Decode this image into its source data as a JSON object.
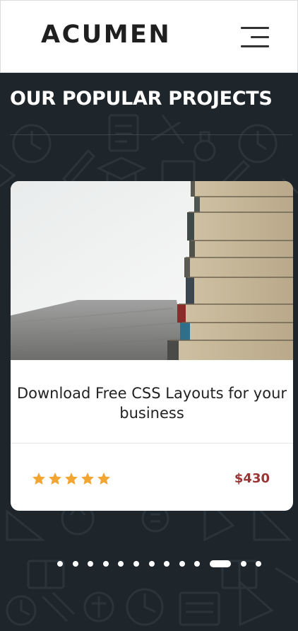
{
  "header": {
    "logo": "ACUMEN",
    "menu_icon": "hamburger-menu-icon"
  },
  "section": {
    "title": "OUR POPULAR PROJECTS"
  },
  "card": {
    "image": "stack-of-books-photo",
    "title": "Download Free CSS Layouts for your business",
    "rating": 5,
    "rating_max": 5,
    "price": "$430"
  },
  "carousel": {
    "dot_count": 13,
    "active_index": 10
  },
  "colors": {
    "section_bg": "#1f262b",
    "star": "#f2a531",
    "price": "#9a3434"
  }
}
